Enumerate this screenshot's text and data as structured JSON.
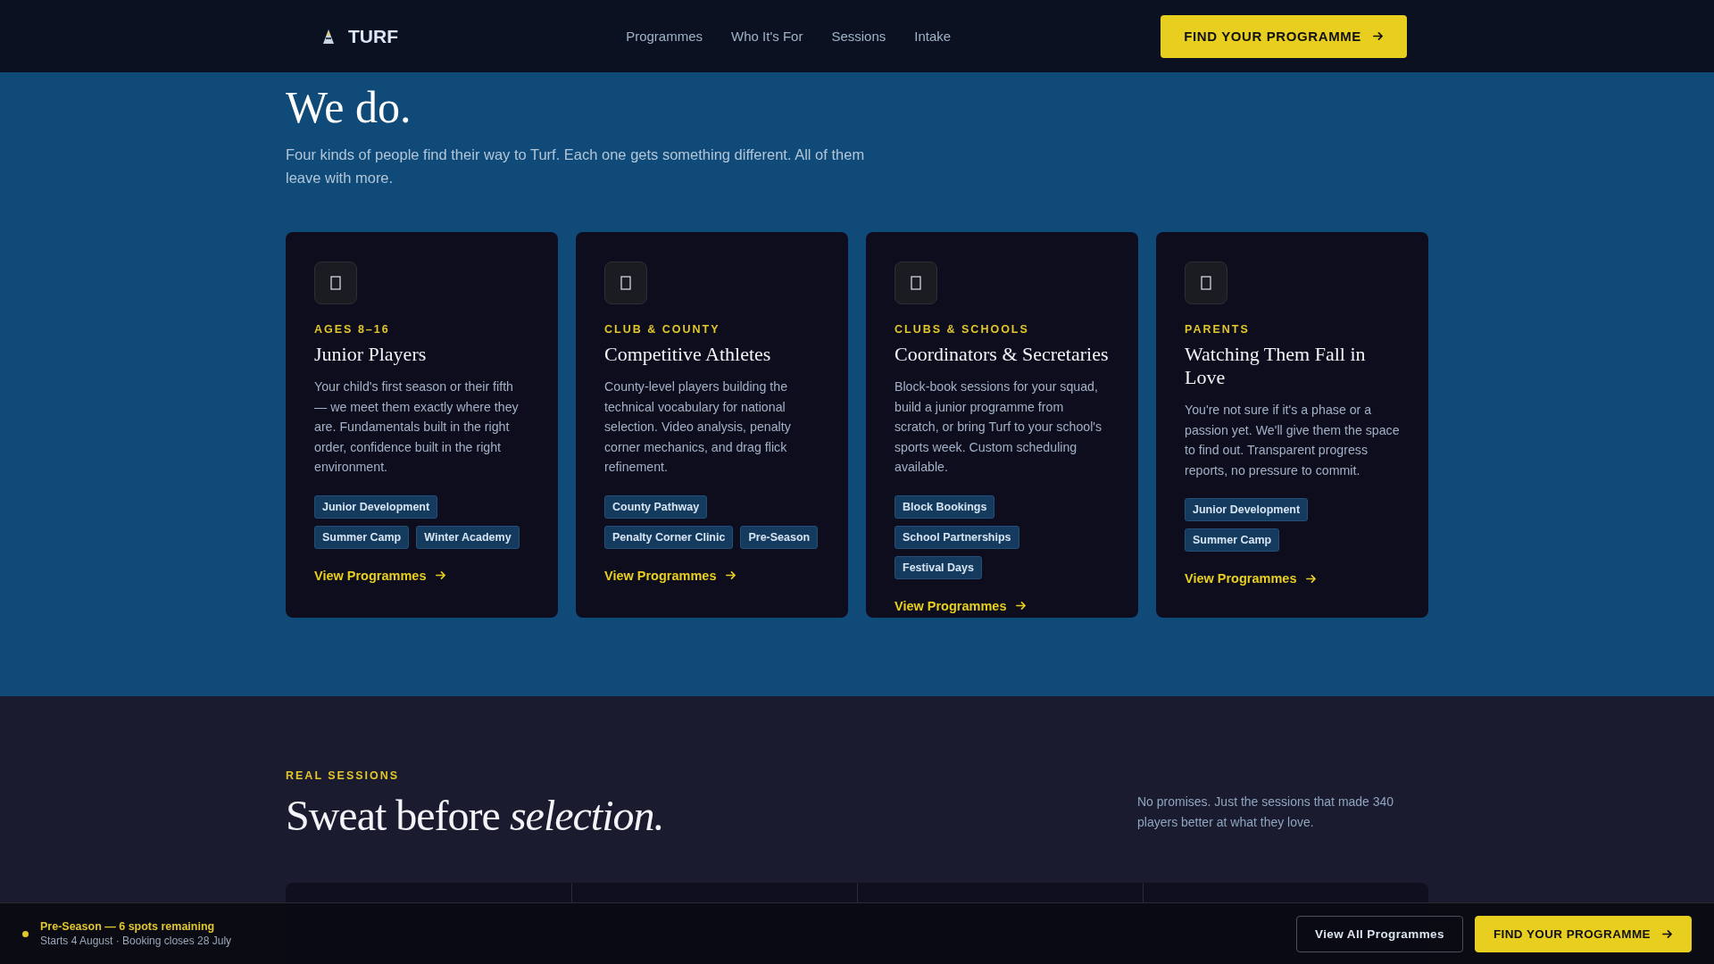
{
  "nav": {
    "logo": "TURF",
    "links": [
      "Programmes",
      "Who It's For",
      "Sessions",
      "Intake"
    ],
    "cta": "FIND YOUR PROGRAMME"
  },
  "hero": {
    "title_lines": [
      "We do."
    ],
    "intro": "Four kinds of people find their way to Turf. Each one gets something different. All of them leave with more."
  },
  "audience_cards": [
    {
      "eyebrow": "AGES 8–16",
      "title": "Junior Players",
      "body": "Your child's first season or their fifth — we meet them exactly where they are. Fundamentals built in the right order, confidence built in the right environment.",
      "tags": [
        "Junior Development",
        "Summer Camp",
        "Winter Academy"
      ],
      "link": "View Programmes"
    },
    {
      "eyebrow": "CLUB & COUNTY",
      "title": "Competitive Athletes",
      "body": "County-level players building the technical vocabulary for national selection. Video analysis, penalty corner mechanics, and drag flick refinement.",
      "tags": [
        "County Pathway",
        "Penalty Corner Clinic",
        "Pre-Season"
      ],
      "link": "View Programmes"
    },
    {
      "eyebrow": "CLUBS & SCHOOLS",
      "title": "Coordinators & Secretaries",
      "body": "Block-book sessions for your squad, build a junior programme from scratch, or bring Turf to your school's sports week. Custom scheduling available.",
      "tags": [
        "Block Bookings",
        "School Partnerships",
        "Festival Days"
      ],
      "link": "View Programmes"
    },
    {
      "eyebrow": "PARENTS",
      "title": "Watching Them Fall in Love",
      "body": "You're not sure if it's a phase or a passion yet. We'll give them the space to find out. Transparent progress reports, no pressure to commit.",
      "tags": [
        "Junior Development",
        "Summer Camp"
      ],
      "link": "View Programmes"
    }
  ],
  "sessions": {
    "eyebrow": "REAL SESSIONS",
    "title": "Sweat before *selection.*",
    "aside": "No promises. Just the sessions that made 340 players better at what they love."
  },
  "sticky_bar": {
    "status": "Pre-Season — 6 spots remaining",
    "detail": "Starts 4 August · Booking closes 28 July",
    "secondary": "View All Programmes",
    "primary": "FIND YOUR PROGRAMME"
  }
}
